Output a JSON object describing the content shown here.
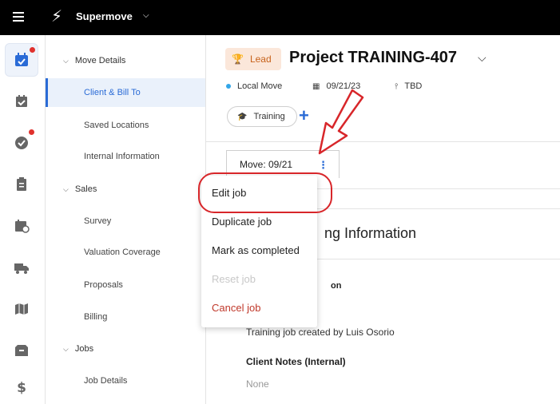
{
  "app": {
    "brand": "Supermove",
    "colors": {
      "topbar": "#000000",
      "accent": "#2a6bd6",
      "lead": "#c7621b",
      "danger": "#d8262a"
    }
  },
  "rail": {
    "items": [
      {
        "icon": "calendar-check-icon",
        "active": true,
        "notify": true
      },
      {
        "icon": "calendar-check-icon",
        "active": false,
        "notify": false
      },
      {
        "icon": "check-circle-icon",
        "active": false,
        "notify": true
      },
      {
        "icon": "clipboard-icon",
        "active": false,
        "notify": false
      },
      {
        "icon": "calendar-clock-icon",
        "active": false,
        "notify": false
      },
      {
        "icon": "truck-icon",
        "active": false,
        "notify": false
      },
      {
        "icon": "map-icon",
        "active": false,
        "notify": false
      },
      {
        "icon": "boxes-icon",
        "active": false,
        "notify": false
      },
      {
        "icon": "dollar-icon",
        "active": false,
        "notify": false
      }
    ]
  },
  "subnav": {
    "move_details": "Move Details",
    "client_bill_to": "Client & Bill To",
    "saved_locations": "Saved Locations",
    "internal_information": "Internal Information",
    "sales": "Sales",
    "survey": "Survey",
    "valuation_coverage": "Valuation Coverage",
    "proposals": "Proposals",
    "billing": "Billing",
    "jobs": "Jobs",
    "job_details": "Job Details"
  },
  "header": {
    "badge": "Lead",
    "title": "Project TRAINING-407",
    "move_type": "Local Move",
    "date": "09/21/23",
    "location": "TBD",
    "tag": "Training"
  },
  "tabs": {
    "move_tab": "Move: 09/21"
  },
  "content": {
    "section_heading": "ng Information",
    "sub_heading": "on",
    "description": "Training job created by Luis Osorio",
    "notes_label": "Client Notes (Internal)",
    "notes_value": "None"
  },
  "menu": {
    "edit": "Edit job",
    "duplicate": "Duplicate job",
    "mark_completed": "Mark as completed",
    "reset": "Reset job",
    "cancel": "Cancel job"
  }
}
